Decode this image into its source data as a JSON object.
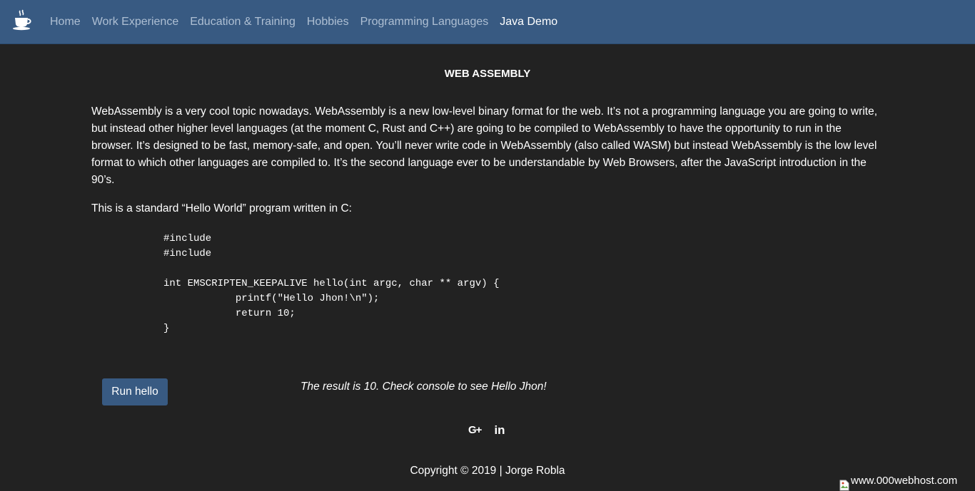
{
  "nav": {
    "brand_icon": "coffee-cup-icon",
    "links": [
      {
        "label": "Home",
        "active": false
      },
      {
        "label": "Work Experience",
        "active": false
      },
      {
        "label": "Education & Training",
        "active": false
      },
      {
        "label": "Hobbies",
        "active": false
      },
      {
        "label": "Programming Languages",
        "active": false
      },
      {
        "label": "Java Demo",
        "active": true
      }
    ]
  },
  "main": {
    "title": "WEB ASSEMBLY",
    "intro": "WebAssembly is a very cool topic nowadays. WebAssembly is a new low-level binary format for the web. It’s not a programming language you are going to write, but instead other higher level languages (at the moment C, Rust and C++) are going to be compiled to WebAssembly to have the opportunity to run in the browser. It’s designed to be fast, memory-safe, and open. You’ll never write code in WebAssembly (also called WASM) but instead WebAssembly is the low level format to which other languages are compiled to. It’s the second language ever to be understandable by Web Browsers, after the JavaScript introduction in the 90’s.",
    "hello_intro": "This is a standard “Hello World” program written in C:",
    "code": "#include\n#include\n\nint EMSCRIPTEN_KEEPALIVE hello(int argc, char ** argv) {\n            printf(\"Hello Jhon!\\n\");\n            return 10;\n}",
    "run_button_label": "Run hello",
    "result_text": "The result is 10. Check console to see Hello Jhon!"
  },
  "footer": {
    "social": [
      {
        "icon": "google-plus-icon",
        "label": "G+"
      },
      {
        "icon": "linkedin-icon",
        "label": "in"
      }
    ],
    "copyright": "Copyright © 2019 | Jorge Robla"
  },
  "host_badge": {
    "alt_text": "www.000webhost.com",
    "icon": "broken-image-icon"
  },
  "colors": {
    "navbar_bg": "#385a82",
    "page_bg": "#222222",
    "button_bg": "#385a82",
    "nav_link": "#aebfd3",
    "nav_link_active": "#ffffff",
    "text": "#ffffff"
  }
}
